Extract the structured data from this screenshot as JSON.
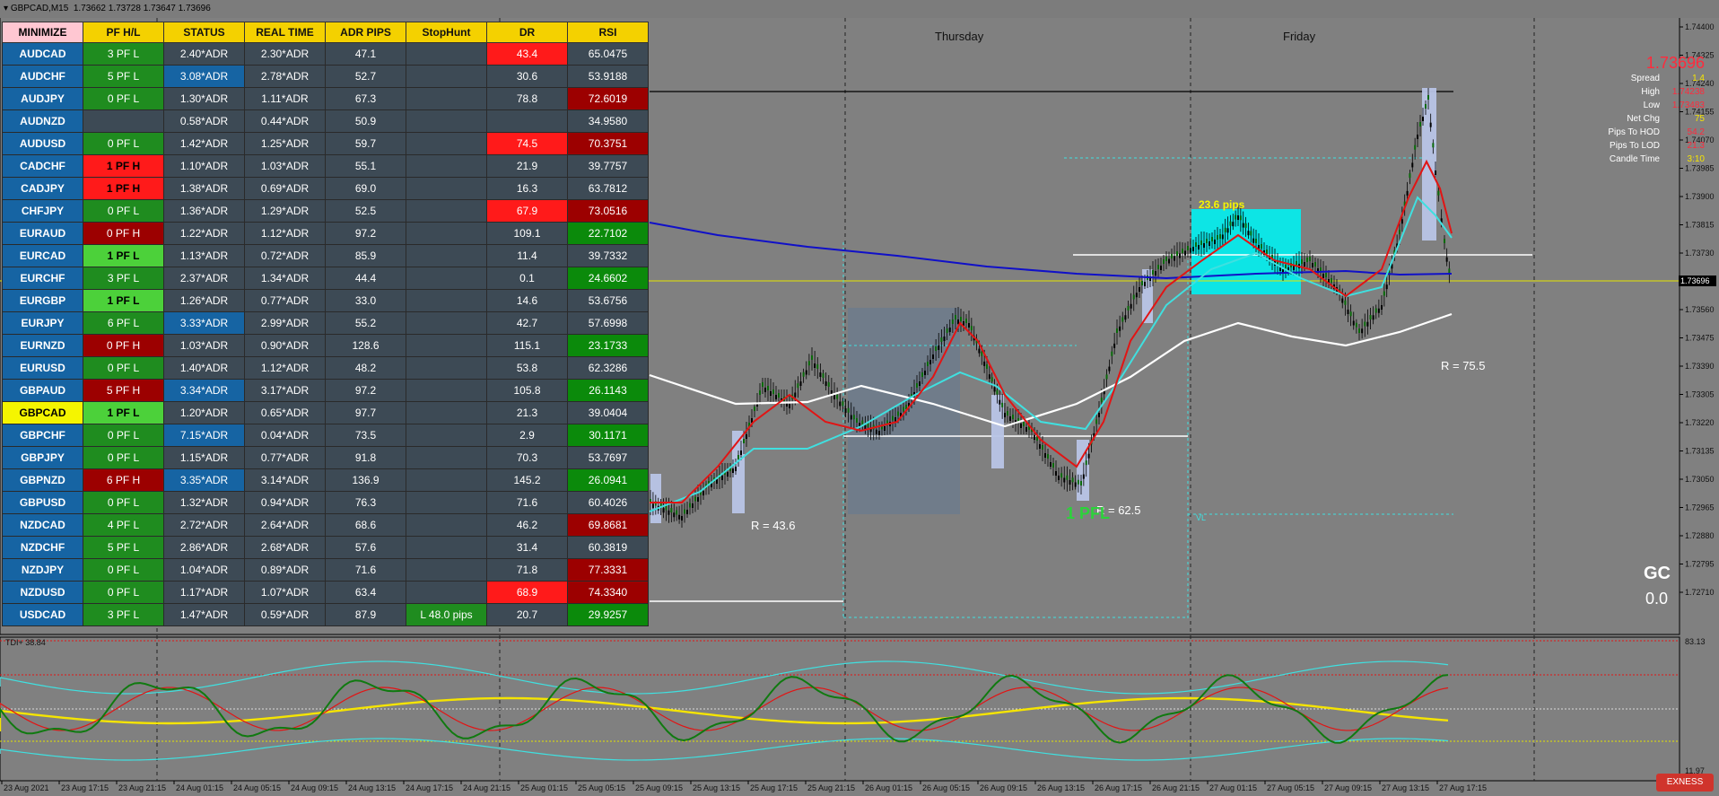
{
  "window": {
    "title": "GBPCAD,M15",
    "ohlc": "1.73662 1.73728 1.73647 1.73696"
  },
  "table": {
    "headers": [
      "MINIMIZE",
      "PF H/L",
      "STATUS",
      "REAL TIME",
      "ADR PIPS",
      "StopHunt",
      "DR",
      "RSI"
    ],
    "rows": [
      {
        "sym": "AUDCAD",
        "pf": "3 PF L",
        "pfc": "pf-green",
        "st": "2.40*ADR",
        "stc": "",
        "rt": "2.30*ADR",
        "adr": "47.1",
        "sh": "",
        "dr": "43.4",
        "drc": "dr-red",
        "rsi": "65.0475",
        "rsic": ""
      },
      {
        "sym": "AUDCHF",
        "pf": "5 PF L",
        "pfc": "pf-green",
        "st": "3.08*ADR",
        "stc": "st-blue",
        "rt": "2.78*ADR",
        "adr": "52.7",
        "sh": "",
        "dr": "30.6",
        "drc": "",
        "rsi": "53.9188",
        "rsic": ""
      },
      {
        "sym": "AUDJPY",
        "pf": "0 PF L",
        "pfc": "pf-green",
        "st": "1.30*ADR",
        "stc": "",
        "rt": "1.11*ADR",
        "adr": "67.3",
        "sh": "",
        "dr": "78.8",
        "drc": "",
        "rsi": "72.6019",
        "rsic": "rsi-red"
      },
      {
        "sym": "AUDNZD",
        "pf": "",
        "pfc": "",
        "st": "0.58*ADR",
        "stc": "",
        "rt": "0.44*ADR",
        "adr": "50.9",
        "sh": "",
        "dr": "",
        "drc": "",
        "rsi": "34.9580",
        "rsic": ""
      },
      {
        "sym": "AUDUSD",
        "pf": "0 PF L",
        "pfc": "pf-green",
        "st": "1.42*ADR",
        "stc": "",
        "rt": "1.25*ADR",
        "adr": "59.7",
        "sh": "",
        "dr": "74.5",
        "drc": "dr-red",
        "rsi": "70.3751",
        "rsic": "rsi-red"
      },
      {
        "sym": "CADCHF",
        "pf": "1 PF H",
        "pfc": "pf-red",
        "st": "1.10*ADR",
        "stc": "",
        "rt": "1.03*ADR",
        "adr": "55.1",
        "sh": "",
        "dr": "21.9",
        "drc": "",
        "rsi": "39.7757",
        "rsic": ""
      },
      {
        "sym": "CADJPY",
        "pf": "1 PF H",
        "pfc": "pf-red",
        "st": "1.38*ADR",
        "stc": "",
        "rt": "0.69*ADR",
        "adr": "69.0",
        "sh": "",
        "dr": "16.3",
        "drc": "",
        "rsi": "63.7812",
        "rsic": ""
      },
      {
        "sym": "CHFJPY",
        "pf": "0 PF L",
        "pfc": "pf-green",
        "st": "1.36*ADR",
        "stc": "",
        "rt": "1.29*ADR",
        "adr": "52.5",
        "sh": "",
        "dr": "67.9",
        "drc": "dr-red",
        "rsi": "73.0516",
        "rsic": "rsi-red"
      },
      {
        "sym": "EURAUD",
        "pf": "0 PF H",
        "pfc": "pf-dred",
        "st": "1.22*ADR",
        "stc": "",
        "rt": "1.12*ADR",
        "adr": "97.2",
        "sh": "",
        "dr": "109.1",
        "drc": "",
        "rsi": "22.7102",
        "rsic": "rsi-green"
      },
      {
        "sym": "EURCAD",
        "pf": "1 PF L",
        "pfc": "pf-lgreen",
        "st": "1.13*ADR",
        "stc": "",
        "rt": "0.72*ADR",
        "adr": "85.9",
        "sh": "",
        "dr": "11.4",
        "drc": "",
        "rsi": "39.7332",
        "rsic": ""
      },
      {
        "sym": "EURCHF",
        "pf": "3 PF L",
        "pfc": "pf-green",
        "st": "2.37*ADR",
        "stc": "",
        "rt": "1.34*ADR",
        "adr": "44.4",
        "sh": "",
        "dr": "0.1",
        "drc": "",
        "rsi": "24.6602",
        "rsic": "rsi-green"
      },
      {
        "sym": "EURGBP",
        "pf": "1 PF L",
        "pfc": "pf-lgreen",
        "st": "1.26*ADR",
        "stc": "",
        "rt": "0.77*ADR",
        "adr": "33.0",
        "sh": "",
        "dr": "14.6",
        "drc": "",
        "rsi": "53.6756",
        "rsic": ""
      },
      {
        "sym": "EURJPY",
        "pf": "6 PF L",
        "pfc": "pf-green",
        "st": "3.33*ADR",
        "stc": "st-blue",
        "rt": "2.99*ADR",
        "adr": "55.2",
        "sh": "",
        "dr": "42.7",
        "drc": "",
        "rsi": "57.6998",
        "rsic": ""
      },
      {
        "sym": "EURNZD",
        "pf": "0 PF H",
        "pfc": "pf-dred",
        "st": "1.03*ADR",
        "stc": "",
        "rt": "0.90*ADR",
        "adr": "128.6",
        "sh": "",
        "dr": "115.1",
        "drc": "",
        "rsi": "23.1733",
        "rsic": "rsi-green"
      },
      {
        "sym": "EURUSD",
        "pf": "0 PF L",
        "pfc": "pf-green",
        "st": "1.40*ADR",
        "stc": "",
        "rt": "1.12*ADR",
        "adr": "48.2",
        "sh": "",
        "dr": "53.8",
        "drc": "",
        "rsi": "62.3286",
        "rsic": ""
      },
      {
        "sym": "GBPAUD",
        "pf": "5 PF H",
        "pfc": "pf-dred",
        "st": "3.34*ADR",
        "stc": "st-blue",
        "rt": "3.17*ADR",
        "adr": "97.2",
        "sh": "",
        "dr": "105.8",
        "drc": "",
        "rsi": "26.1143",
        "rsic": "rsi-green"
      },
      {
        "sym": "GBPCAD",
        "pf": "1 PF L",
        "pfc": "pf-lgreen",
        "st": "1.20*ADR",
        "stc": "",
        "rt": "0.65*ADR",
        "adr": "97.7",
        "sh": "",
        "dr": "21.3",
        "drc": "",
        "rsi": "39.0404",
        "rsic": "",
        "sel": true
      },
      {
        "sym": "GBPCHF",
        "pf": "0 PF L",
        "pfc": "pf-green",
        "st": "7.15*ADR",
        "stc": "st-blue",
        "rt": "0.04*ADR",
        "adr": "73.5",
        "sh": "",
        "dr": "2.9",
        "drc": "",
        "rsi": "30.1171",
        "rsic": "rsi-green"
      },
      {
        "sym": "GBPJPY",
        "pf": "0 PF L",
        "pfc": "pf-green",
        "st": "1.15*ADR",
        "stc": "",
        "rt": "0.77*ADR",
        "adr": "91.8",
        "sh": "",
        "dr": "70.3",
        "drc": "",
        "rsi": "53.7697",
        "rsic": ""
      },
      {
        "sym": "GBPNZD",
        "pf": "6 PF H",
        "pfc": "pf-dred",
        "st": "3.35*ADR",
        "stc": "st-blue",
        "rt": "3.14*ADR",
        "adr": "136.9",
        "sh": "",
        "dr": "145.2",
        "drc": "",
        "rsi": "26.0941",
        "rsic": "rsi-green"
      },
      {
        "sym": "GBPUSD",
        "pf": "0 PF L",
        "pfc": "pf-green",
        "st": "1.32*ADR",
        "stc": "",
        "rt": "0.94*ADR",
        "adr": "76.3",
        "sh": "",
        "dr": "71.6",
        "drc": "",
        "rsi": "60.4026",
        "rsic": ""
      },
      {
        "sym": "NZDCAD",
        "pf": "4 PF L",
        "pfc": "pf-green",
        "st": "2.72*ADR",
        "stc": "",
        "rt": "2.64*ADR",
        "adr": "68.6",
        "sh": "",
        "dr": "46.2",
        "drc": "",
        "rsi": "69.8681",
        "rsic": "rsi-red"
      },
      {
        "sym": "NZDCHF",
        "pf": "5 PF L",
        "pfc": "pf-green",
        "st": "2.86*ADR",
        "stc": "",
        "rt": "2.68*ADR",
        "adr": "57.6",
        "sh": "",
        "dr": "31.4",
        "drc": "",
        "rsi": "60.3819",
        "rsic": ""
      },
      {
        "sym": "NZDJPY",
        "pf": "0 PF L",
        "pfc": "pf-green",
        "st": "1.04*ADR",
        "stc": "",
        "rt": "0.89*ADR",
        "adr": "71.6",
        "sh": "",
        "dr": "71.8",
        "drc": "",
        "rsi": "77.3331",
        "rsic": "rsi-red"
      },
      {
        "sym": "NZDUSD",
        "pf": "0 PF L",
        "pfc": "pf-green",
        "st": "1.17*ADR",
        "stc": "",
        "rt": "1.07*ADR",
        "adr": "63.4",
        "sh": "",
        "dr": "68.9",
        "drc": "dr-red",
        "rsi": "74.3340",
        "rsic": "rsi-red"
      },
      {
        "sym": "USDCAD",
        "pf": "3 PF L",
        "pfc": "pf-green",
        "st": "1.47*ADR",
        "stc": "",
        "rt": "0.59*ADR",
        "adr": "87.9",
        "sh": "L 48.0 pips",
        "shc": "sh-green",
        "dr": "20.7",
        "drc": "",
        "rsi": "29.9257",
        "rsic": "rsi-green"
      }
    ]
  },
  "days": {
    "thursday": "Thursday",
    "friday": "Friday"
  },
  "price_axis": [
    "1.74400",
    "1.74325",
    "1.74240",
    "1.74155",
    "1.74070",
    "1.73985",
    "1.73900",
    "1.73815",
    "1.73730",
    "1.73645",
    "1.73560",
    "1.73475",
    "1.73390",
    "1.73305",
    "1.73220",
    "1.73135",
    "1.73050",
    "1.72965",
    "1.72880",
    "1.72795",
    "1.72710"
  ],
  "current_price_badge": "1.73696",
  "indicator_axis": {
    "top": "83.13",
    "bottom": "11.97"
  },
  "time_axis": [
    "23 Aug 2021",
    "23 Aug 17:15",
    "23 Aug 21:15",
    "24 Aug 01:15",
    "24 Aug 05:15",
    "24 Aug 09:15",
    "24 Aug 13:15",
    "24 Aug 17:15",
    "24 Aug 21:15",
    "25 Aug 01:15",
    "25 Aug 05:15",
    "25 Aug 09:15",
    "25 Aug 13:15",
    "25 Aug 17:15",
    "25 Aug 21:15",
    "26 Aug 01:15",
    "26 Aug 05:15",
    "26 Aug 09:15",
    "26 Aug 13:15",
    "26 Aug 17:15",
    "26 Aug 21:15",
    "27 Aug 01:15",
    "27 Aug 05:15",
    "27 Aug 09:15",
    "27 Aug 13:15",
    "27 Aug 17:15"
  ],
  "info": {
    "price": "1.73696",
    "rows": [
      {
        "k": "Spread",
        "v": "1.4",
        "c": "#f5e400"
      },
      {
        "k": "High",
        "v": "1.74238",
        "c": "#ff2a3c"
      },
      {
        "k": "Low",
        "v": "1.73483",
        "c": "#ff2a3c"
      },
      {
        "k": "Net Chg",
        "v": "75",
        "c": "#f5e400"
      },
      {
        "k": "Pips To HOD",
        "v": "54.2",
        "c": "#ff2a3c"
      },
      {
        "k": "Pips To LOD",
        "v": "21.3",
        "c": "#ff2a3c"
      },
      {
        "k": "Candle Time",
        "v": "3:10",
        "c": "#f5e400"
      }
    ]
  },
  "annotations": {
    "r1": "R = 43.6",
    "r2": "R = 62.5",
    "r3": "R = 75.5",
    "pips": "23.6 pips",
    "pfl": "1 PFL",
    "vl": "VL"
  },
  "gc": {
    "label": "GC",
    "value": "0.0"
  },
  "tdi_label": "TDI+ 38.84",
  "logo": "EXNESS"
}
